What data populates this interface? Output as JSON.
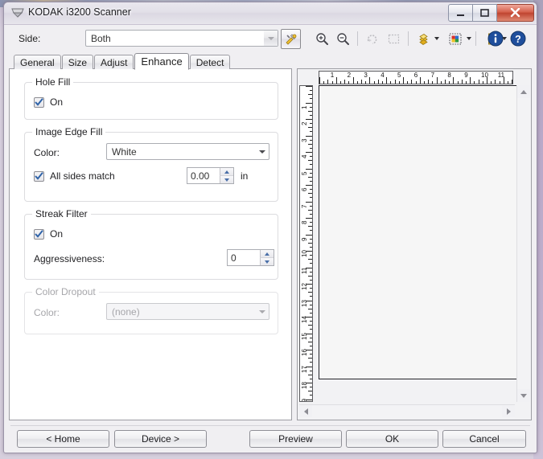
{
  "window": {
    "title": "KODAK i3200 Scanner",
    "icon": "scanner-icon",
    "minimize_label": "Minimize",
    "maximize_label": "Maximize",
    "close_label": "Close"
  },
  "toprow": {
    "side_label": "Side:",
    "side_value": "Both",
    "config_icon": "wrench-screwdriver-icon"
  },
  "toolbar": {
    "items": [
      {
        "name": "zoom-in-icon",
        "label": "Zoom In",
        "enabled": true
      },
      {
        "name": "zoom-out-icon",
        "label": "Zoom Out",
        "enabled": true
      },
      {
        "name": "rotate-icon",
        "label": "Rotate",
        "enabled": false
      },
      {
        "name": "select-area-icon",
        "label": "Select Area",
        "enabled": false
      },
      {
        "name": "image-stack-icon",
        "label": "Images",
        "enabled": true
      },
      {
        "name": "color-mode-icon",
        "label": "Color Mode",
        "enabled": true
      },
      {
        "name": "ruler-units-icon",
        "label": "Units",
        "enabled": true
      },
      {
        "name": "info-icon",
        "label": "Information",
        "enabled": true
      },
      {
        "name": "help-icon",
        "label": "Help",
        "enabled": true
      }
    ]
  },
  "tabs": [
    {
      "label": "General",
      "active": false
    },
    {
      "label": "Size",
      "active": false
    },
    {
      "label": "Adjust",
      "active": false
    },
    {
      "label": "Enhance",
      "active": true
    },
    {
      "label": "Detect",
      "active": false
    }
  ],
  "panel": {
    "hole_fill": {
      "legend": "Hole Fill",
      "on_label": "On",
      "on_checked": true
    },
    "image_edge_fill": {
      "legend": "Image Edge Fill",
      "color_label": "Color:",
      "color_value": "White",
      "all_sides_label": "All sides match",
      "all_sides_checked": true,
      "value": "0.00",
      "unit": "in"
    },
    "streak_filter": {
      "legend": "Streak Filter",
      "on_label": "On",
      "on_checked": true,
      "aggressiveness_label": "Aggressiveness:",
      "aggressiveness_value": "0"
    },
    "color_dropout": {
      "legend": "Color Dropout",
      "color_label": "Color:",
      "color_value": "(none)",
      "disabled": true
    }
  },
  "preview": {
    "h_ruler_max": 12,
    "v_ruler_max": 20,
    "unit": "in",
    "scroll_up_icon": "scroll-up-arrow",
    "scroll_down_icon": "scroll-down-arrow",
    "scroll_left_icon": "scroll-left-arrow",
    "scroll_right_icon": "scroll-right-arrow"
  },
  "footer": {
    "buttons": [
      {
        "label": "< Home",
        "name": "home-button"
      },
      {
        "label": "Device >",
        "name": "device-button"
      },
      {
        "label": "Preview",
        "name": "preview-button"
      },
      {
        "label": "OK",
        "name": "ok-button"
      },
      {
        "label": "Cancel",
        "name": "cancel-button"
      }
    ]
  },
  "colors": {
    "accent_blue": "#1f4e9c",
    "close_red": "#c04b35",
    "window_bg": "#f0eff2",
    "panel_bg": "#ffffff"
  }
}
